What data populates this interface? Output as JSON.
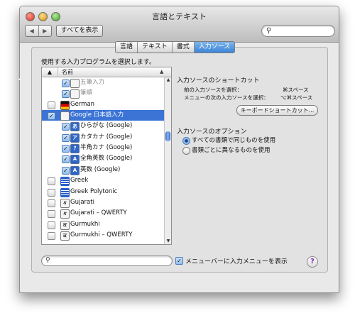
{
  "window": {
    "title": "言語とテキスト"
  },
  "toolbar": {
    "back_label": "◀",
    "forward_label": "▶",
    "show_all_label": "すべてを表示",
    "search_placeholder": ""
  },
  "tabs": [
    {
      "label": "言語",
      "active": false
    },
    {
      "label": "テキスト",
      "active": false
    },
    {
      "label": "書式",
      "active": false
    },
    {
      "label": "入力ソース",
      "active": true
    }
  ],
  "input_sources": {
    "prompt": "使用する入力プログラムを選択します。",
    "column_name": "名前",
    "rows": [
      {
        "label": "五筆入力",
        "checked": true,
        "icon": "brush-icon",
        "glyph": "",
        "indent": true,
        "grey": true
      },
      {
        "label": "筆順",
        "checked": true,
        "icon": "brush-icon",
        "glyph": "",
        "indent": true,
        "grey": true
      },
      {
        "label": "German",
        "checked": false,
        "icon": "german-flag-icon",
        "glyph": "",
        "indent": false
      },
      {
        "label": "Google 日本語入力",
        "checked": true,
        "icon": "google-ime-icon",
        "glyph": "",
        "indent": false,
        "selected": true
      },
      {
        "label": "ひらがな (Google)",
        "checked": true,
        "icon": "hiragana-icon",
        "glyph": "あ",
        "indent": true
      },
      {
        "label": "カタカナ (Google)",
        "checked": true,
        "icon": "katakana-icon",
        "glyph": "ア",
        "indent": true
      },
      {
        "label": "半角カナ (Google)",
        "checked": true,
        "icon": "halfwidth-katakana-icon",
        "glyph": "ｱ",
        "indent": true
      },
      {
        "label": "全角英数 (Google)",
        "checked": true,
        "icon": "fullwidth-alnum-icon",
        "glyph": "A",
        "indent": true
      },
      {
        "label": "英数 (Google)",
        "checked": true,
        "icon": "alnum-icon",
        "glyph": "A",
        "indent": true
      },
      {
        "label": "Greek",
        "checked": false,
        "icon": "greek-flag-icon",
        "glyph": "",
        "indent": false
      },
      {
        "label": "Greek Polytonic",
        "checked": false,
        "icon": "greek-polytonic-icon",
        "glyph": "",
        "indent": false
      },
      {
        "label": "Gujarati",
        "checked": false,
        "icon": "gujarati-icon",
        "glyph": "ક",
        "indent": false
      },
      {
        "label": "Gujarati – QWERTY",
        "checked": false,
        "icon": "gujarati-qwerty-icon",
        "glyph": "ક",
        "indent": false
      },
      {
        "label": "Gurmukhi",
        "checked": false,
        "icon": "gurmukhi-icon",
        "glyph": "ਕ",
        "indent": false
      },
      {
        "label": "Gurmukhi – QWERTY",
        "checked": false,
        "icon": "gurmukhi-qwerty-icon",
        "glyph": "ਕ",
        "indent": false
      }
    ]
  },
  "shortcuts": {
    "title": "入力ソースのショートカット",
    "items": [
      {
        "label": "前の入力ソースを選択：",
        "key": "⌘スペース"
      },
      {
        "label": "メニューの次の入力ソースを選択：",
        "key": "⌥⌘スペース"
      }
    ],
    "keyboard_button": "キーボードショートカット..."
  },
  "options": {
    "title": "入力ソースのオプション",
    "choices": [
      {
        "label": "すべての書類で同じものを使用",
        "selected": true
      },
      {
        "label": "書類ごとに異なるものを使用",
        "selected": false
      }
    ]
  },
  "bottom": {
    "search_placeholder": "",
    "menu_checkbox_label": "メニューバーに入力メニューを表示",
    "menu_checked": true,
    "help_label": "?"
  }
}
